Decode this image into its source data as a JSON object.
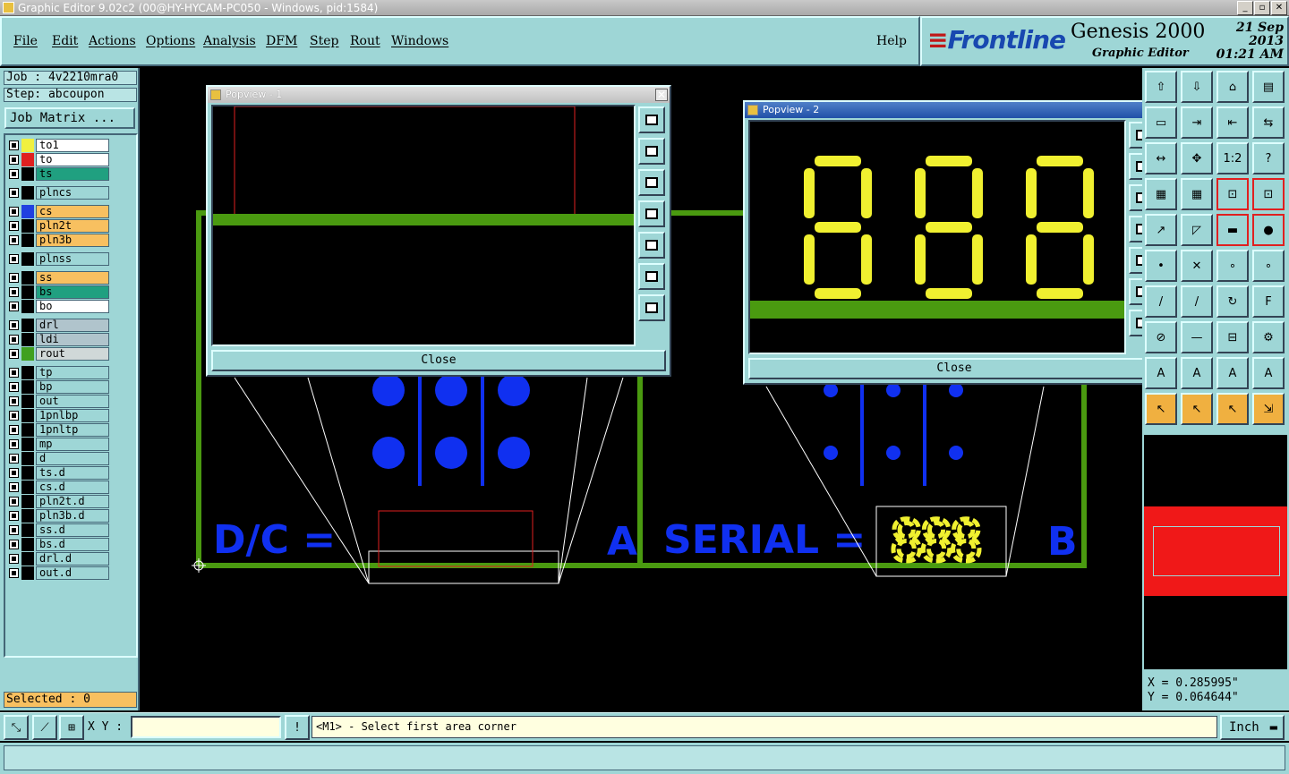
{
  "window": {
    "title": "Graphic Editor 9.02c2 (00@HY-HYCAM-PC050 - Windows, pid:1584)"
  },
  "menu": {
    "items": [
      "File",
      "Edit",
      "Actions",
      "Options",
      "Analysis",
      "DFM",
      "Step",
      "Rout",
      "Windows"
    ],
    "help": "Help"
  },
  "brand": {
    "logo": "Frontline",
    "product": "Genesis 2000",
    "module": "Graphic Editor",
    "date": "21 Sep 2013",
    "time": "01:21 AM"
  },
  "job": {
    "job_label": "Job : 4v2210mra0",
    "step_label": "Step: abcoupon",
    "job_matrix": "Job Matrix ..."
  },
  "layers": [
    {
      "name": "to1",
      "color": "#f0f040",
      "fill": "#ffffff",
      "checked": true
    },
    {
      "name": "to",
      "color": "#e02020",
      "fill": "#ffffff",
      "checked": true,
      "active": true
    },
    {
      "name": "ts",
      "color": "#000000",
      "fill": "#20a080",
      "checked": true
    },
    {
      "name": "plncs",
      "color": "#000000",
      "fill": "#9ed6d6",
      "checked": true
    },
    {
      "name": "cs",
      "color": "#2040e0",
      "fill": "#f8c060",
      "checked": true
    },
    {
      "name": "pln2t",
      "color": "#000000",
      "fill": "#f8c060",
      "checked": true
    },
    {
      "name": "pln3b",
      "color": "#000000",
      "fill": "#f8c060",
      "checked": true
    },
    {
      "name": "plnss",
      "color": "#000000",
      "fill": "#9ed6d6",
      "checked": true
    },
    {
      "name": "ss",
      "color": "#000000",
      "fill": "#f8c060",
      "checked": true
    },
    {
      "name": "bs",
      "color": "#000000",
      "fill": "#20a080",
      "checked": true
    },
    {
      "name": "bo",
      "color": "#000000",
      "fill": "#ffffff",
      "checked": true
    },
    {
      "name": "drl",
      "color": "#000000",
      "fill": "#b0c4cc",
      "checked": true
    },
    {
      "name": "ldi",
      "color": "#000000",
      "fill": "#b0c4cc",
      "checked": true
    },
    {
      "name": "rout",
      "color": "#40a020",
      "fill": "#d0d8d8",
      "checked": true
    },
    {
      "name": "tp",
      "color": "#000000",
      "fill": "#9ed6d6",
      "checked": true
    },
    {
      "name": "bp",
      "color": "#000000",
      "fill": "#9ed6d6",
      "checked": true
    },
    {
      "name": "out",
      "color": "#000000",
      "fill": "#9ed6d6",
      "checked": true
    },
    {
      "name": "1pnlbp",
      "color": "#000000",
      "fill": "#9ed6d6",
      "checked": true
    },
    {
      "name": "1pnltp",
      "color": "#000000",
      "fill": "#9ed6d6",
      "checked": true
    },
    {
      "name": "mp",
      "color": "#000000",
      "fill": "#9ed6d6",
      "checked": true
    },
    {
      "name": "d",
      "color": "#000000",
      "fill": "#9ed6d6",
      "checked": true
    },
    {
      "name": "ts.d",
      "color": "#000000",
      "fill": "#9ed6d6",
      "checked": true
    },
    {
      "name": "cs.d",
      "color": "#000000",
      "fill": "#9ed6d6",
      "checked": true
    },
    {
      "name": "pln2t.d",
      "color": "#000000",
      "fill": "#9ed6d6",
      "checked": true
    },
    {
      "name": "pln3b.d",
      "color": "#000000",
      "fill": "#9ed6d6",
      "checked": true
    },
    {
      "name": "ss.d",
      "color": "#000000",
      "fill": "#9ed6d6",
      "checked": true
    },
    {
      "name": "bs.d",
      "color": "#000000",
      "fill": "#9ed6d6",
      "checked": true
    },
    {
      "name": "drl.d",
      "color": "#000000",
      "fill": "#9ed6d6",
      "checked": true
    },
    {
      "name": "out.d",
      "color": "#000000",
      "fill": "#9ed6d6",
      "checked": true
    }
  ],
  "selected": "Selected : 0",
  "canvas": {
    "dc_text": "D/C =",
    "a_text": "A",
    "serial_text": "SERIAL =",
    "b_text": "B",
    "digits": "888"
  },
  "popview1": {
    "title": "Popview - 1",
    "close": "Close"
  },
  "popview2": {
    "title": "Popview - 2",
    "close": "Close"
  },
  "coords": {
    "x": "X = 0.285995\"",
    "y": "Y = 0.064644\""
  },
  "status": {
    "xy_label": "X Y :",
    "xy_value": "",
    "prompt": "<M1> - Select first area corner",
    "units": "Inch"
  },
  "colors": {
    "panel": "#9ed6d6",
    "trace": "#4a9a10",
    "silk": "#1030f0",
    "digit": "#f0f030"
  }
}
